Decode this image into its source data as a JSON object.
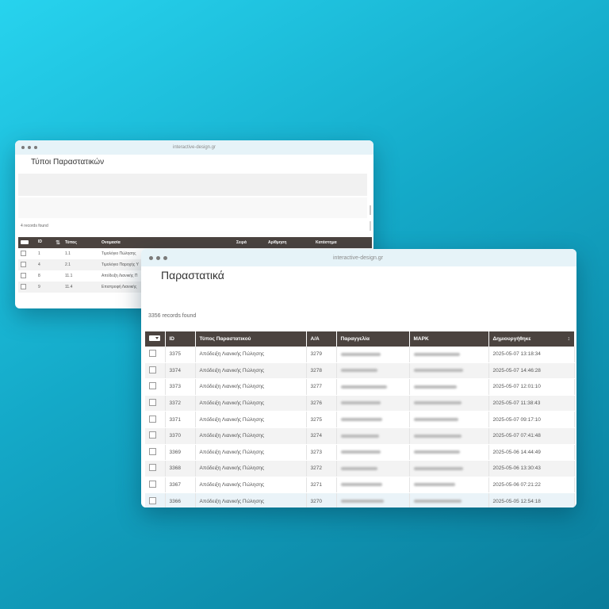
{
  "back_window": {
    "url": "interactive-design.gr",
    "title": "Τύποι Παραστατικών",
    "records_found": "4 records found",
    "columns": [
      "ID",
      "Τύπος",
      "Ονομασία",
      "Σειρά",
      "Αρίθμηση",
      "Κατάστημα"
    ],
    "rows": [
      {
        "id": "1",
        "type": "1.1",
        "name": "Τιμολόγιο Πώλησης"
      },
      {
        "id": "4",
        "type": "2.1",
        "name": "Τιμολόγιο Παροχής Υ"
      },
      {
        "id": "8",
        "type": "11.1",
        "name": "Απόδειξη Λιανικής Π"
      },
      {
        "id": "9",
        "type": "11.4",
        "name": "Επιστροφή Λιανικής"
      }
    ]
  },
  "front_window": {
    "url": "interactive-design.gr",
    "title": "Παραστατικά",
    "records_found": "3356 records found",
    "columns": [
      "ID",
      "Τύπος Παραστατικού",
      "Α/Α",
      "Παραγγελία",
      "ΜΑΡΚ",
      "Δημιουργήθηκε"
    ],
    "sort_icon": "sort-arrow-icon",
    "rows": [
      {
        "id": "3375",
        "type": "Απόδειξη Λιανικής Πώλησης",
        "aa": "3279",
        "created": "2025-05-07 13:18:34"
      },
      {
        "id": "3374",
        "type": "Απόδειξη Λιανικής Πώλησης",
        "aa": "3278",
        "created": "2025-05-07 14:46:28"
      },
      {
        "id": "3373",
        "type": "Απόδειξη Λιανικής Πώλησης",
        "aa": "3277",
        "created": "2025-05-07 12:01:10"
      },
      {
        "id": "3372",
        "type": "Απόδειξη Λιανικής Πώλησης",
        "aa": "3276",
        "created": "2025-05-07 11:38:43"
      },
      {
        "id": "3371",
        "type": "Απόδειξη Λιανικής Πώλησης",
        "aa": "3275",
        "created": "2025-05-07 09:17:10"
      },
      {
        "id": "3370",
        "type": "Απόδειξη Λιανικής Πώλησης",
        "aa": "3274",
        "created": "2025-05-07 07:41:48"
      },
      {
        "id": "3369",
        "type": "Απόδειξη Λιανικής Πώλησης",
        "aa": "3273",
        "created": "2025-05-06 14:44:49"
      },
      {
        "id": "3368",
        "type": "Απόδειξη Λιανικής Πώλησης",
        "aa": "3272",
        "created": "2025-05-06 13:30:43"
      },
      {
        "id": "3367",
        "type": "Απόδειξη Λιανικής Πώλησης",
        "aa": "3271",
        "created": "2025-05-06 07:21:22"
      },
      {
        "id": "3366",
        "type": "Απόδειξη Λιανικής Πώλησης",
        "aa": "3270",
        "created": "2025-05-05 12:54:18"
      }
    ]
  },
  "colors": {
    "header_bg": "#4b433f",
    "titlebar_bg": "#e6f3f8",
    "background_start": "#27d3ee",
    "background_end": "#0a7c9a"
  }
}
